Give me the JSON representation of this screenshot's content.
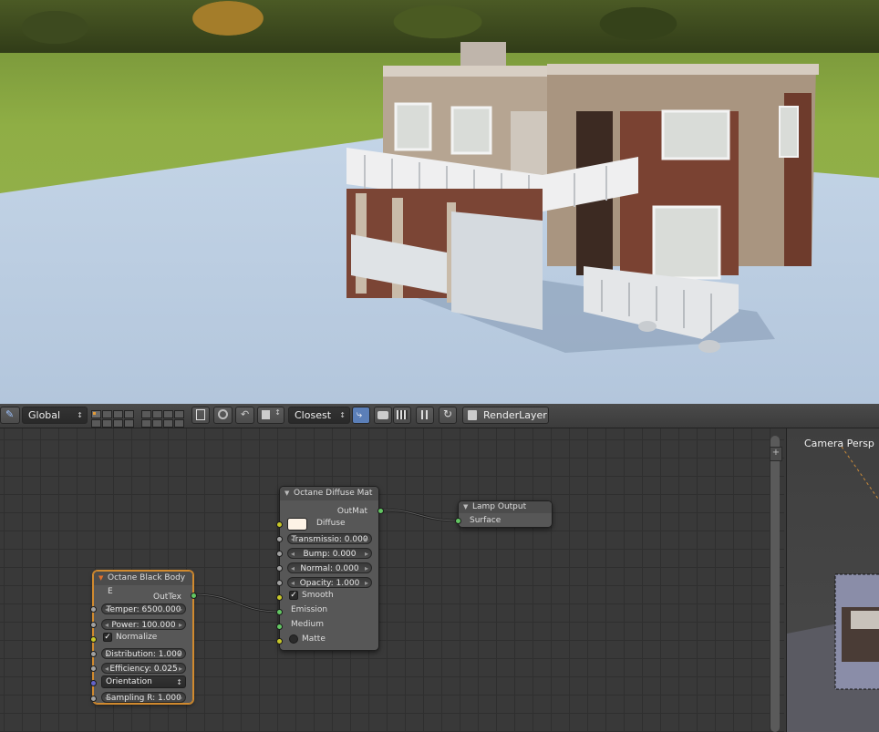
{
  "toolbar": {
    "pivot_label": "Global",
    "snap_label": "Closest",
    "render_layer_label": "RenderLayer"
  },
  "view3d": {
    "label": "Camera Persp"
  },
  "nodes": {
    "diffuse": {
      "title": "Octane Diffuse Mat",
      "out_label": "OutMat",
      "diffuse_label": "Diffuse",
      "diffuse_color": "#fdf3e6",
      "transmission": "Transmissio: 0.000",
      "bump": "Bump: 0.000",
      "normal": "Normal: 0.000",
      "opacity": "Opacity: 1.000",
      "smooth_label": "Smooth",
      "emission_label": "Emission",
      "medium_label": "Medium",
      "matte_label": "Matte"
    },
    "lamp": {
      "title": "Lamp Output",
      "surface_label": "Surface"
    },
    "blackbody": {
      "title": "Octane Black Body E",
      "out_label": "OutTex",
      "temperature": "Temper: 6500.000",
      "power": "Power: 100.000",
      "normalize_label": "Normalize",
      "distribution": "Distribution: 1.000",
      "efficiency": "Efficiency: 0.025",
      "orientation": "Orientation",
      "sampling": "Sampling R: 1.000"
    }
  },
  "colors": {
    "selected_outline": "#d18a2e",
    "socket_green": "#63c763",
    "socket_yellow": "#c7c729",
    "socket_grey": "#a1a1a1",
    "socket_blue": "#6363c7"
  }
}
